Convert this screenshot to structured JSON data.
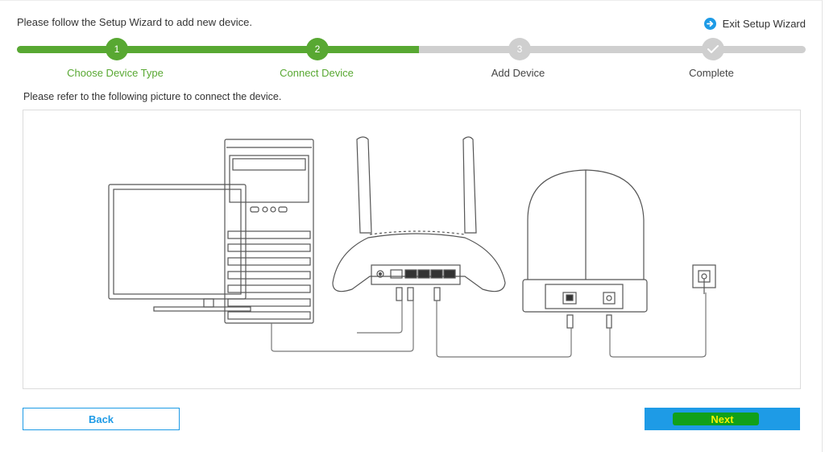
{
  "header": {
    "intro": "Please follow the Setup Wizard to add new device.",
    "exit_label": "Exit Setup Wizard",
    "exit_icon": "arrow-right-circle-icon"
  },
  "steps": [
    {
      "number": "1",
      "label": "Choose Device Type",
      "state": "done"
    },
    {
      "number": "2",
      "label": "Connect Device",
      "state": "done"
    },
    {
      "number": "3",
      "label": "Add Device",
      "state": "todo"
    },
    {
      "number": "",
      "label": "Complete",
      "state": "todo"
    }
  ],
  "progress": {
    "completed_steps": 2,
    "total_steps": 4
  },
  "main": {
    "instruction": "Please refer to the following picture to connect the device."
  },
  "buttons": {
    "back": "Back",
    "next": "Next"
  },
  "colors": {
    "accent_green": "#58a832",
    "accent_blue": "#1e9be6",
    "inactive_gray": "#cfcfcf",
    "next_text": "#f3f000"
  }
}
